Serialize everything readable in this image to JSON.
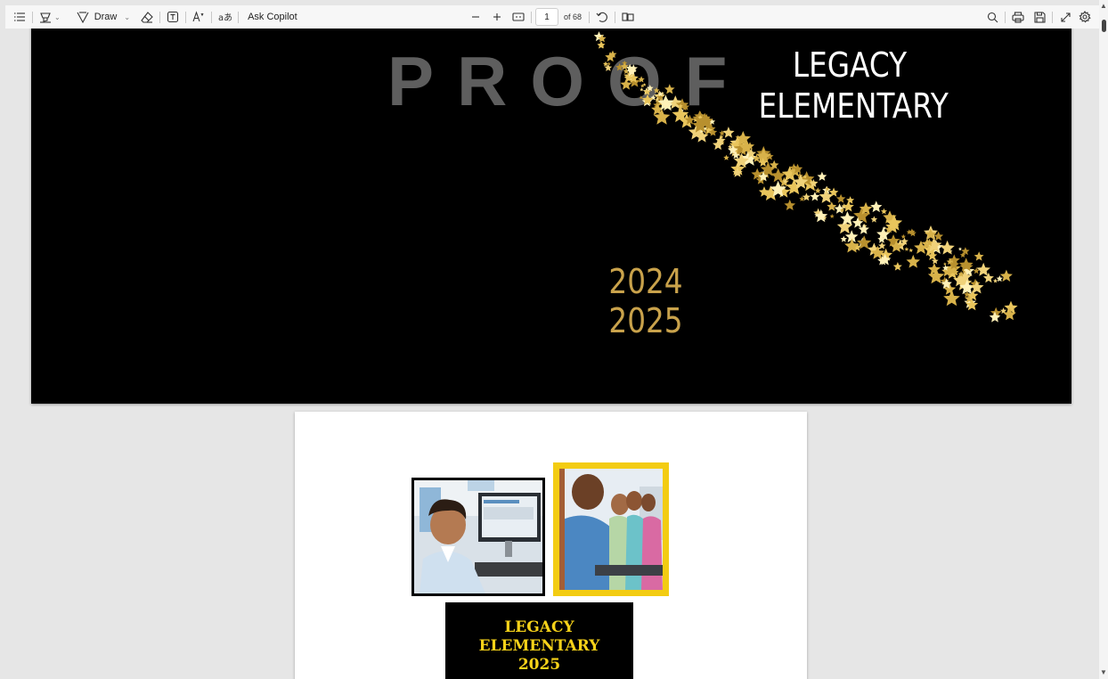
{
  "toolbar": {
    "contents_icon": "list-icon",
    "highlight_icon": "highlighter-icon",
    "draw_label": "Draw",
    "eraser_icon": "eraser-icon",
    "text_box_icon": "text-box-icon",
    "read_aloud_icon": "read-aloud-icon",
    "translate_icon": "translate-icon",
    "ask_copilot_label": "Ask Copilot",
    "zoom_out_icon": "minus-icon",
    "zoom_in_icon": "plus-icon",
    "fit_icon": "fit-page-icon",
    "page_current": "1",
    "page_total_text": "of 68",
    "rotate_icon": "rotate-icon",
    "page_view_icon": "two-page-icon",
    "search_icon": "search-icon",
    "print_icon": "print-icon",
    "save_icon": "save-icon",
    "fullscreen_icon": "expand-icon",
    "settings_icon": "gear-icon"
  },
  "document": {
    "page1": {
      "watermark": "PROOF",
      "school_line1": "LEGACY",
      "school_line2": "ELEMENTARY",
      "year1": "2024",
      "year2": "2025"
    },
    "page2": {
      "label_line1": "LEGACY",
      "label_line2": "ELEMENTARY",
      "label_line3": "2025"
    }
  },
  "colors": {
    "gold": "#c9a24b",
    "yellow": "#f6d219",
    "photo_border_yellow": "#f3cc12",
    "toolbar_bg": "#f7f7f7",
    "viewer_bg": "#e6e6e6"
  }
}
